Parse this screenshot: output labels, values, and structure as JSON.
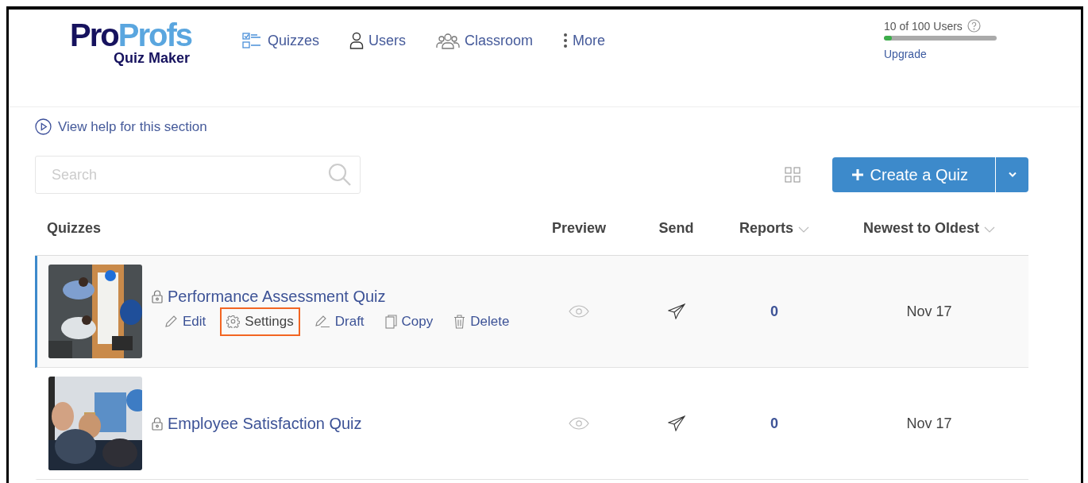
{
  "logo": {
    "word_parts": [
      "Pro",
      "Profs"
    ],
    "subtitle": "Quiz Maker"
  },
  "nav": [
    {
      "kind": "quizzes",
      "label": "Quizzes"
    },
    {
      "kind": "users",
      "label": "Users"
    },
    {
      "kind": "classroom",
      "label": "Classroom"
    },
    {
      "kind": "more",
      "label": "More"
    }
  ],
  "usage": {
    "used": "10",
    "of": "of",
    "total": "100 Users",
    "level": 0.07,
    "upgrade": "Upgrade"
  },
  "help_link": "View help for this section",
  "search": {
    "placeholder": "Search"
  },
  "create_button": "Create a Quiz",
  "table": {
    "columns": [
      {
        "label": "Quizzes",
        "sortable": false
      },
      {
        "label": "Preview",
        "sortable": false
      },
      {
        "label": "Send",
        "sortable": false
      },
      {
        "label": "Reports",
        "sortable": true
      },
      {
        "label": "Newest to Oldest",
        "sortable": true
      }
    ],
    "rows": [
      {
        "title": "Performance Assessment Quiz",
        "selected": true,
        "reports": "0",
        "date": "Nov 17",
        "actions": [
          {
            "kind": "edit",
            "label": "Edit",
            "highlighted": false
          },
          {
            "kind": "settings",
            "label": "Settings",
            "highlighted": true
          },
          {
            "kind": "draft",
            "label": "Draft",
            "highlighted": false
          },
          {
            "kind": "copy",
            "label": "Copy",
            "highlighted": false
          },
          {
            "kind": "delete",
            "label": "Delete",
            "highlighted": false
          }
        ]
      },
      {
        "title": "Employee Satisfaction Quiz",
        "selected": false,
        "reports": "0",
        "date": "Nov 17",
        "actions": []
      }
    ]
  }
}
